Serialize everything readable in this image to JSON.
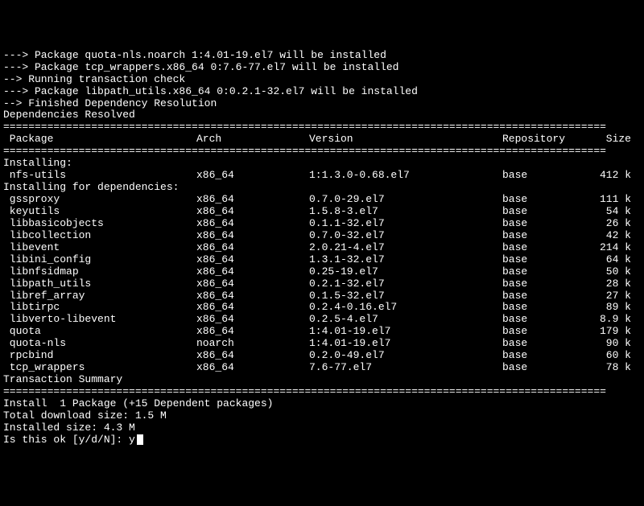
{
  "preamble": [
    "---> Package quota-nls.noarch 1:4.01-19.el7 will be installed",
    "---> Package tcp_wrappers.x86_64 0:7.6-77.el7 will be installed",
    "--> Running transaction check",
    "---> Package libpath_utils.x86_64 0:0.2.1-32.el7 will be installed",
    "--> Finished Dependency Resolution"
  ],
  "deps_resolved": "Dependencies Resolved",
  "divider": "================================================================================================",
  "headers": {
    "package": " Package",
    "arch": "Arch",
    "version": "Version",
    "repository": "Repository",
    "size": "Size"
  },
  "sections": {
    "installing": "Installing:",
    "installing_deps": "Installing for dependencies:"
  },
  "installing": [
    {
      "name": " nfs-utils",
      "arch": "x86_64",
      "version": "1:1.3.0-0.68.el7",
      "repo": "base",
      "size": "412 k"
    }
  ],
  "deps": [
    {
      "name": " gssproxy",
      "arch": "x86_64",
      "version": "0.7.0-29.el7",
      "repo": "base",
      "size": "111 k"
    },
    {
      "name": " keyutils",
      "arch": "x86_64",
      "version": "1.5.8-3.el7",
      "repo": "base",
      "size": "54 k"
    },
    {
      "name": " libbasicobjects",
      "arch": "x86_64",
      "version": "0.1.1-32.el7",
      "repo": "base",
      "size": "26 k"
    },
    {
      "name": " libcollection",
      "arch": "x86_64",
      "version": "0.7.0-32.el7",
      "repo": "base",
      "size": "42 k"
    },
    {
      "name": " libevent",
      "arch": "x86_64",
      "version": "2.0.21-4.el7",
      "repo": "base",
      "size": "214 k"
    },
    {
      "name": " libini_config",
      "arch": "x86_64",
      "version": "1.3.1-32.el7",
      "repo": "base",
      "size": "64 k"
    },
    {
      "name": " libnfsidmap",
      "arch": "x86_64",
      "version": "0.25-19.el7",
      "repo": "base",
      "size": "50 k"
    },
    {
      "name": " libpath_utils",
      "arch": "x86_64",
      "version": "0.2.1-32.el7",
      "repo": "base",
      "size": "28 k"
    },
    {
      "name": " libref_array",
      "arch": "x86_64",
      "version": "0.1.5-32.el7",
      "repo": "base",
      "size": "27 k"
    },
    {
      "name": " libtirpc",
      "arch": "x86_64",
      "version": "0.2.4-0.16.el7",
      "repo": "base",
      "size": "89 k"
    },
    {
      "name": " libverto-libevent",
      "arch": "x86_64",
      "version": "0.2.5-4.el7",
      "repo": "base",
      "size": "8.9 k"
    },
    {
      "name": " quota",
      "arch": "x86_64",
      "version": "1:4.01-19.el7",
      "repo": "base",
      "size": "179 k"
    },
    {
      "name": " quota-nls",
      "arch": "noarch",
      "version": "1:4.01-19.el7",
      "repo": "base",
      "size": "90 k"
    },
    {
      "name": " rpcbind",
      "arch": "x86_64",
      "version": "0.2.0-49.el7",
      "repo": "base",
      "size": "60 k"
    },
    {
      "name": " tcp_wrappers",
      "arch": "x86_64",
      "version": "7.6-77.el7",
      "repo": "base",
      "size": "78 k"
    }
  ],
  "summary_header": "Transaction Summary",
  "summary_line": "Install  1 Package (+15 Dependent packages)",
  "total_download": "Total download size: 1.5 M",
  "installed_size": "Installed size: 4.3 M",
  "prompt": "Is this ok [y/d/N]: ",
  "prompt_answer": "y"
}
